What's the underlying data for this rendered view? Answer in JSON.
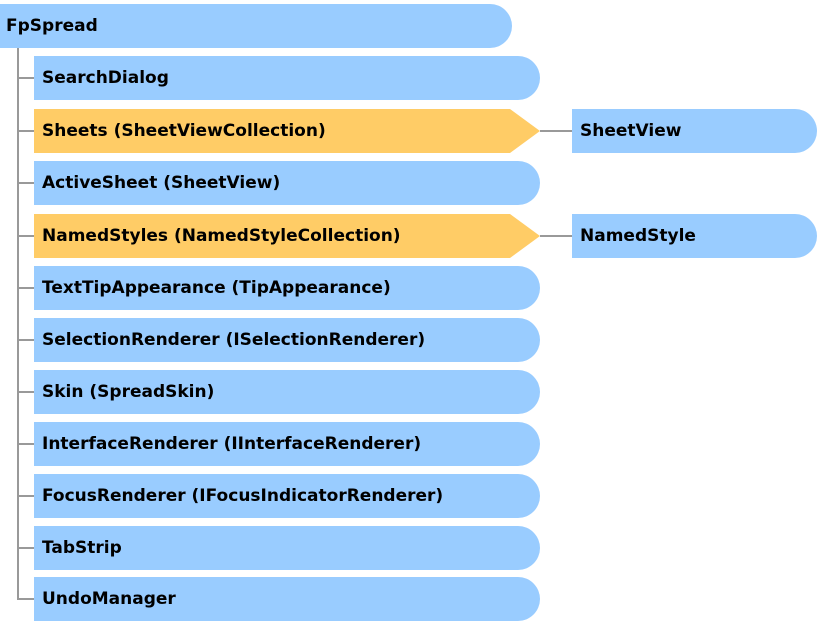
{
  "root": {
    "label": "FpSpread"
  },
  "children": [
    {
      "label": "SearchDialog",
      "type": "object"
    },
    {
      "label": "Sheets (SheetViewCollection)",
      "type": "collection",
      "child": "SheetView"
    },
    {
      "label": "ActiveSheet (SheetView)",
      "type": "object"
    },
    {
      "label": "NamedStyles (NamedStyleCollection)",
      "type": "collection",
      "child": "NamedStyle"
    },
    {
      "label": "TextTipAppearance (TipAppearance)",
      "type": "object"
    },
    {
      "label": "SelectionRenderer (ISelectionRenderer)",
      "type": "object"
    },
    {
      "label": "Skin (SpreadSkin)",
      "type": "object"
    },
    {
      "label": "InterfaceRenderer (IInterfaceRenderer)",
      "type": "object"
    },
    {
      "label": "FocusRenderer (IFocusIndicatorRenderer)",
      "type": "object"
    },
    {
      "label": "TabStrip",
      "type": "object"
    },
    {
      "label": "UndoManager",
      "type": "object"
    }
  ],
  "colors": {
    "object": "#99ccff",
    "collection": "#ffcc66",
    "connector": "#999999"
  }
}
